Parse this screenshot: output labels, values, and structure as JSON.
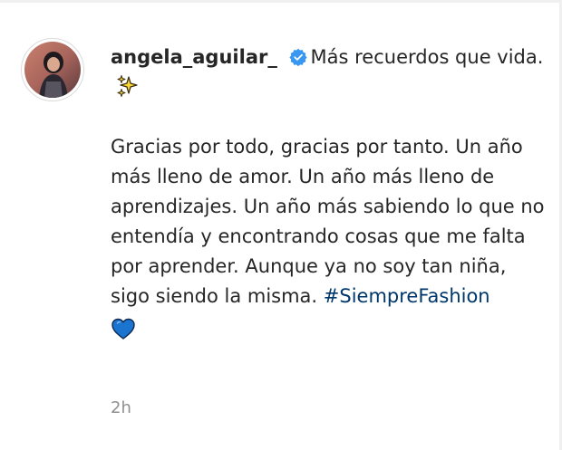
{
  "comment": {
    "username": "angela_aguilar_",
    "verified_icon": "verified-badge-icon",
    "caption_first": "Más recuerdos que vida.",
    "sparkle_icon": "sparkles-emoji",
    "body_text": "Gracias por todo, gracias por tanto. Un año más lleno de amor. Un año más lleno de aprendizajes. Un año más sabiendo lo que no entendía y encontrando cosas que me falta por aprender. Aunque ya no soy tan niña, sigo siendo la misma.",
    "hashtag": "#SiempreFashion",
    "heart_icon": "blue-heart-emoji",
    "timestamp": "2h"
  },
  "colors": {
    "text": "#262626",
    "hashtag": "#00376b",
    "muted": "#8e8e8e",
    "verified": "#3897f0",
    "heart": "#1b75d0"
  }
}
